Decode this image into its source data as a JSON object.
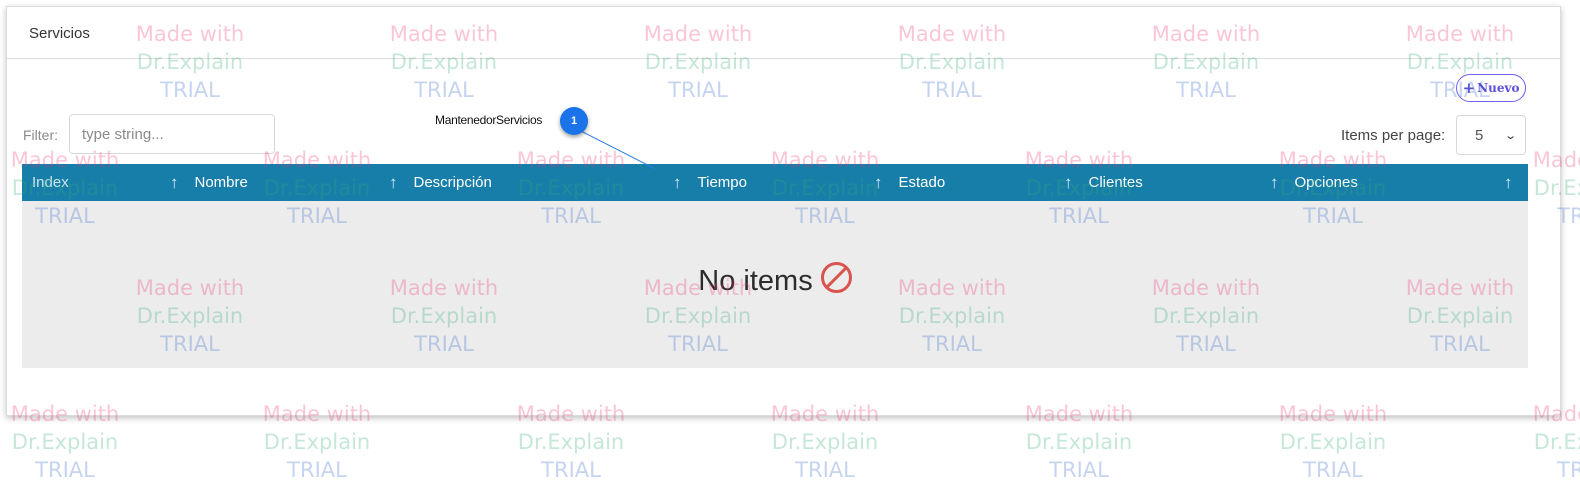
{
  "header": {
    "title": "Servicios"
  },
  "toolbar": {
    "new_button_label": "Nuevo",
    "new_button_icon": "plus-icon"
  },
  "filter": {
    "label": "Filter:",
    "placeholder": "type string..."
  },
  "pagination": {
    "items_label": "Items per page:",
    "selected": "5"
  },
  "table": {
    "columns": [
      {
        "label": "Index",
        "sortable": false
      },
      {
        "label": "Nombre",
        "sortable": true
      },
      {
        "label": "Descripción",
        "sortable": true
      },
      {
        "label": "Tiempo",
        "sortable": true
      },
      {
        "label": "Estado",
        "sortable": true
      },
      {
        "label": "Clientes",
        "sortable": true
      },
      {
        "label": "Opciones",
        "sortable": true
      }
    ],
    "empty_text": "No items",
    "empty_icon": "ban-icon",
    "header_color": "#167ea8"
  },
  "callout": {
    "label": "MantenedorServicios",
    "number": "1"
  },
  "watermark": {
    "line1": "Made with",
    "line2": "Dr.Explain",
    "line3": "TRIAL"
  }
}
